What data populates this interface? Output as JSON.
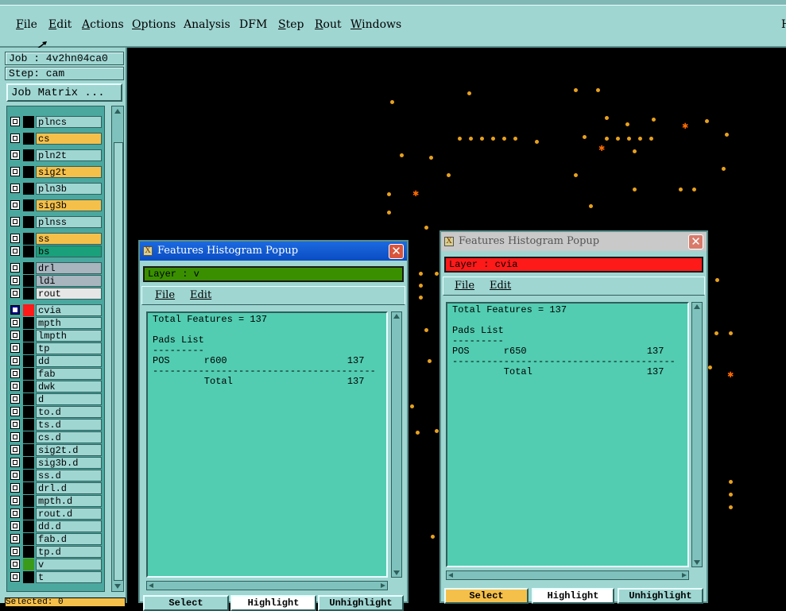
{
  "menu": {
    "items": [
      "File",
      "Edit",
      "Actions",
      "Options",
      "Analysis",
      "DFM",
      "Step",
      "Rout",
      "Windows"
    ],
    "underline": [
      "F",
      "E",
      "A",
      "O",
      "",
      "",
      "S",
      "R",
      "W"
    ],
    "right_label": "H"
  },
  "left_panel": {
    "job": "Job : 4v2hn04ca0",
    "step": "Step: cam",
    "job_matrix": "Job Matrix ...",
    "layers": [
      {
        "name": "plncs",
        "color": "#9fd6d2"
      },
      {
        "name": "cs",
        "color": "#f5c04a"
      },
      {
        "name": "pln2t",
        "color": "#9fd6d2"
      },
      {
        "name": "sig2t",
        "color": "#f5c04a"
      },
      {
        "name": "pln3b",
        "color": "#9fd6d2"
      },
      {
        "name": "sig3b",
        "color": "#f5c04a"
      },
      {
        "name": "plnss",
        "color": "#9fd6d2"
      },
      {
        "name": "ss",
        "color": "#f5c04a"
      },
      {
        "name": "bs",
        "color": "#1aa07a"
      },
      {
        "name": "drl",
        "color": "#a8b4be"
      },
      {
        "name": "ldi",
        "color": "#a8b4be"
      },
      {
        "name": "rout",
        "color": "#e6e6e6"
      },
      {
        "name": "cvia",
        "color": "#9fd6d2",
        "selected": true,
        "swatch": "#ff1a1a"
      },
      {
        "name": "mpth",
        "color": "#9fd6d2"
      },
      {
        "name": "lmpth",
        "color": "#9fd6d2"
      },
      {
        "name": "tp",
        "color": "#9fd6d2"
      },
      {
        "name": "dd",
        "color": "#9fd6d2"
      },
      {
        "name": "fab",
        "color": "#9fd6d2"
      },
      {
        "name": "dwk",
        "color": "#9fd6d2"
      },
      {
        "name": "d",
        "color": "#9fd6d2"
      },
      {
        "name": "to.d",
        "color": "#9fd6d2"
      },
      {
        "name": "ts.d",
        "color": "#9fd6d2"
      },
      {
        "name": "cs.d",
        "color": "#9fd6d2"
      },
      {
        "name": "sig2t.d",
        "color": "#9fd6d2"
      },
      {
        "name": "sig3b.d",
        "color": "#9fd6d2"
      },
      {
        "name": "ss.d",
        "color": "#9fd6d2"
      },
      {
        "name": "drl.d",
        "color": "#9fd6d2"
      },
      {
        "name": "mpth.d",
        "color": "#9fd6d2"
      },
      {
        "name": "rout.d",
        "color": "#9fd6d2"
      },
      {
        "name": "dd.d",
        "color": "#9fd6d2"
      },
      {
        "name": "fab.d",
        "color": "#9fd6d2"
      },
      {
        "name": "tp.d",
        "color": "#9fd6d2"
      },
      {
        "name": "v",
        "color": "#9fd6d2",
        "swatch": "#3a9a1a"
      },
      {
        "name": "t",
        "color": "#9fd6d2"
      }
    ],
    "selected_count": "Selected: 0"
  },
  "popup_left": {
    "title": "Features Histogram Popup",
    "layer_label": "Layer :  v",
    "layer_color": "#3a8f00",
    "menu": [
      "File",
      "Edit"
    ],
    "content": "Total Features = 137\n\nPads List\n---------\nPOS      r600                     137\n---------------------------------------\n         Total                    137",
    "buttons": [
      "Select",
      "Highlight",
      "Unhighlight"
    ]
  },
  "popup_right": {
    "title": "Features Histogram Popup",
    "layer_label": "Layer :  cvia",
    "layer_color": "#ff1a1a",
    "menu": [
      "File",
      "Edit"
    ],
    "content": "Total Features = 137\n\nPads List\n---------\nPOS      r650                     137\n---------------------------------------\n         Total                    137",
    "buttons": [
      "Select",
      "Highlight",
      "Unhighlight"
    ]
  }
}
